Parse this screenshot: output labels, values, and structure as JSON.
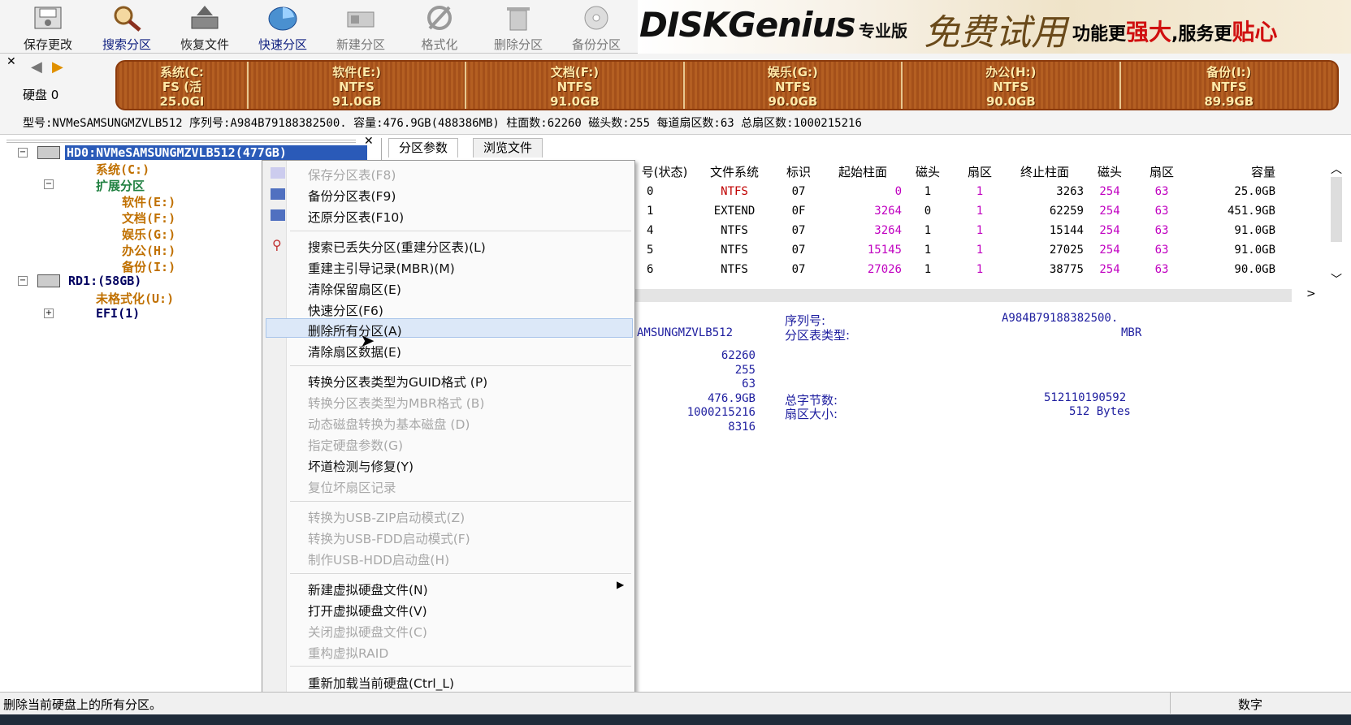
{
  "toolbar": {
    "save": "保存更改",
    "search": "搜索分区",
    "recover": "恢复文件",
    "quick": "快速分区",
    "new": "新建分区",
    "format": "格式化",
    "delete": "删除分区",
    "backup": "备份分区"
  },
  "banner": {
    "logo": "DISKGenius",
    "edition": "专业版",
    "trial": "免费试用",
    "slogan1": "功能更",
    "slogan2": "强大",
    "slogan3": ",服务更",
    "slogan4": "贴心"
  },
  "disk_label": "硬盘 0",
  "segments": [
    {
      "name": "系统(C:",
      "fs": "FS (活",
      "size": "25.0GI"
    },
    {
      "name": "软件(E:)",
      "fs": "NTFS",
      "size": "91.0GB"
    },
    {
      "name": "文档(F:)",
      "fs": "NTFS",
      "size": "91.0GB"
    },
    {
      "name": "娱乐(G:)",
      "fs": "NTFS",
      "size": "90.0GB"
    },
    {
      "name": "办公(H:)",
      "fs": "NTFS",
      "size": "90.0GB"
    },
    {
      "name": "备份(I:)",
      "fs": "NTFS",
      "size": "89.9GB"
    }
  ],
  "disk_info": "型号:NVMeSAMSUNGMZVLB512   序列号:A984B79188382500.   容量:476.9GB(488386MB)   柱面数:62260   磁头数:255   每道扇区数:63   总扇区数:1000215216",
  "tree": {
    "hd0": "HD0:NVMeSAMSUNGMZVLB512(477GB)",
    "c": "系统(C:)",
    "ext": "扩展分区",
    "e": "软件(E:)",
    "f": "文档(F:)",
    "g": "娱乐(G:)",
    "h": "办公(H:)",
    "i": "备份(I:)",
    "rd1": "RD1:(58GB)",
    "u": "未格式化(U:)",
    "efi": "EFI(1)"
  },
  "tabs": {
    "params": "分区参数",
    "browse": "浏览文件"
  },
  "table": {
    "headers": [
      "号(状态)",
      "文件系统",
      "标识",
      "起始柱面",
      "磁头",
      "扇区",
      "终止柱面",
      "磁头",
      "扇区",
      "容量"
    ],
    "rows": [
      [
        "0",
        "NTFS",
        "07",
        "0",
        "1",
        "1",
        "3263",
        "254",
        "63",
        "25.0GB"
      ],
      [
        "1",
        "EXTEND",
        "0F",
        "3264",
        "0",
        "1",
        "62259",
        "254",
        "63",
        "451.9GB"
      ],
      [
        "4",
        "NTFS",
        "07",
        "3264",
        "1",
        "1",
        "15144",
        "254",
        "63",
        "91.0GB"
      ],
      [
        "5",
        "NTFS",
        "07",
        "15145",
        "1",
        "1",
        "27025",
        "254",
        "63",
        "91.0GB"
      ],
      [
        "6",
        "NTFS",
        "07",
        "27026",
        "1",
        "1",
        "38775",
        "254",
        "63",
        "90.0GB"
      ]
    ]
  },
  "details": {
    "model_partial": "AMSUNGMZVLB512",
    "serial_label": "序列号:",
    "serial_value": "A984B79188382500.",
    "ptype_label": "分区表类型:",
    "ptype_value": "MBR",
    "cyl": "62260",
    "heads": "255",
    "sectors": "63",
    "capacity": "476.9GB",
    "total_sectors": "1000215216",
    "extra": "8316",
    "bytes_label": "总字节数:",
    "bytes_value": "512110190592",
    "secsize_label": "扇区大小:",
    "secsize_value": "512 Bytes"
  },
  "menu": [
    {
      "label": "保存分区表(F8)",
      "disabled": true
    },
    {
      "label": "备份分区表(F9)",
      "disabled": false
    },
    {
      "label": "还原分区表(F10)",
      "disabled": false
    },
    {
      "label": "搜索已丢失分区(重建分区表)(L)",
      "disabled": false
    },
    {
      "label": "重建主引导记录(MBR)(M)",
      "disabled": false
    },
    {
      "label": "清除保留扇区(E)",
      "disabled": false
    },
    {
      "label": "快速分区(F6)",
      "disabled": false
    },
    {
      "label": "删除所有分区(A)",
      "disabled": false
    },
    {
      "label": "清除扇区数据(E)",
      "disabled": false
    },
    {
      "label": "转换分区表类型为GUID格式 (P)",
      "disabled": false
    },
    {
      "label": "转换分区表类型为MBR格式 (B)",
      "disabled": true
    },
    {
      "label": "动态磁盘转换为基本磁盘 (D)",
      "disabled": true
    },
    {
      "label": "指定硬盘参数(G)",
      "disabled": true
    },
    {
      "label": "坏道检测与修复(Y)",
      "disabled": false
    },
    {
      "label": "复位坏扇区记录",
      "disabled": true
    },
    {
      "label": "转换为USB-ZIP启动模式(Z)",
      "disabled": true
    },
    {
      "label": "转换为USB-FDD启动模式(F)",
      "disabled": true
    },
    {
      "label": "制作USB-HDD启动盘(H)",
      "disabled": true
    },
    {
      "label": "新建虚拟硬盘文件(N)",
      "disabled": false
    },
    {
      "label": "打开虚拟硬盘文件(V)",
      "disabled": false
    },
    {
      "label": "关闭虚拟硬盘文件(C)",
      "disabled": true
    },
    {
      "label": "重构虚拟RAID",
      "disabled": true
    },
    {
      "label": "重新加载当前硬盘(Ctrl_L)",
      "disabled": false
    }
  ],
  "status": {
    "text": "删除当前硬盘上的所有分区。",
    "mode": "数字"
  }
}
